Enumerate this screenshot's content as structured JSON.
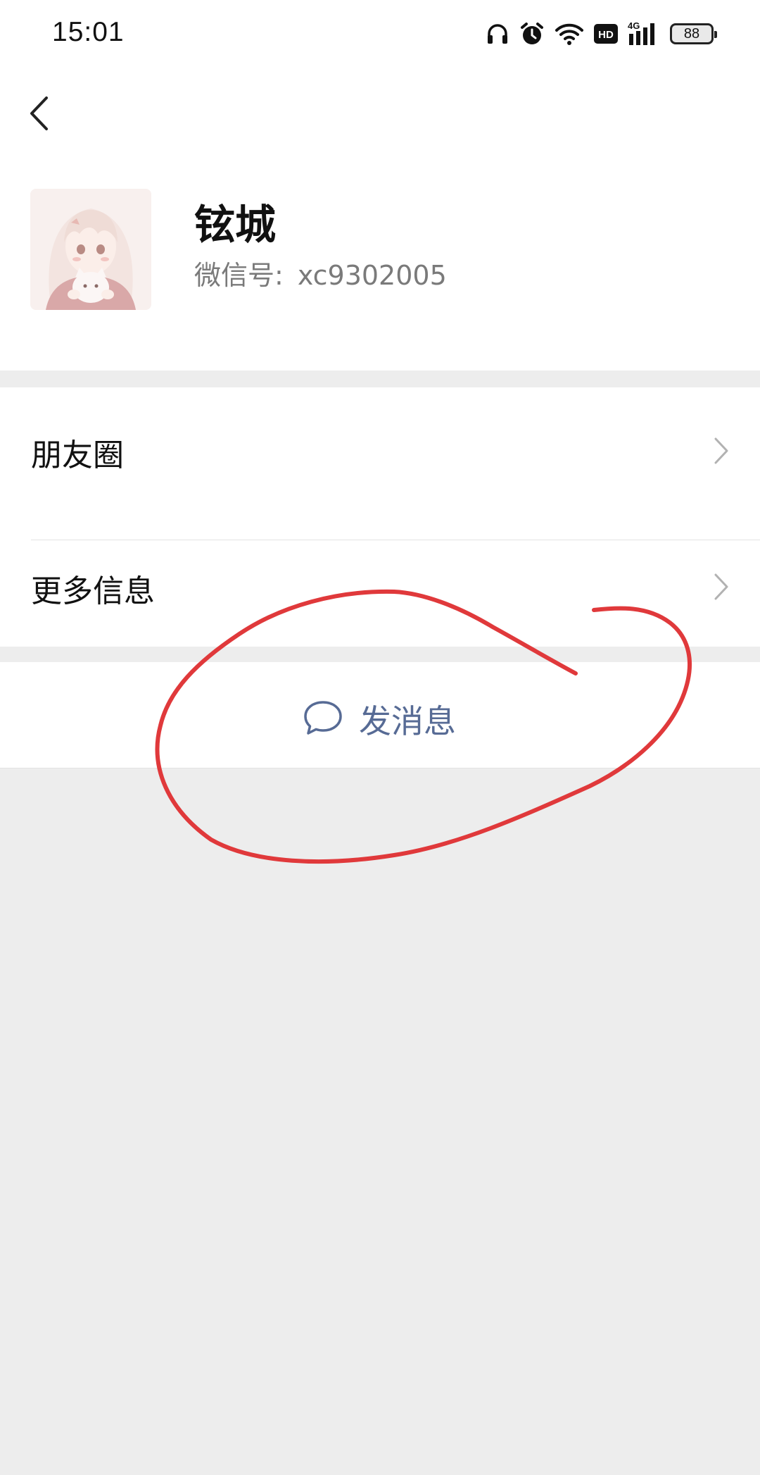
{
  "status_bar": {
    "time": "15:01",
    "battery": "88",
    "network": "4G",
    "hd": "HD",
    "icons": [
      "headphones-icon",
      "alarm-icon",
      "wifi-icon",
      "hd-icon",
      "4g-signal-icon",
      "battery-icon"
    ]
  },
  "nav": {
    "back_icon": "chevron-left-icon"
  },
  "profile": {
    "name": "铉城",
    "id_label": "微信号:",
    "id_value": "xc9302005"
  },
  "menu": {
    "items": [
      {
        "label": "朋友圈",
        "icon": "chevron-right-icon"
      },
      {
        "label": "更多信息",
        "icon": "chevron-right-icon"
      }
    ]
  },
  "actions": {
    "send_message_label": "发消息",
    "send_message_icon": "chat-bubble-icon"
  },
  "colors": {
    "background": "#ededed",
    "card": "#ffffff",
    "link": "#576b95",
    "annotation": "#e0393b"
  }
}
